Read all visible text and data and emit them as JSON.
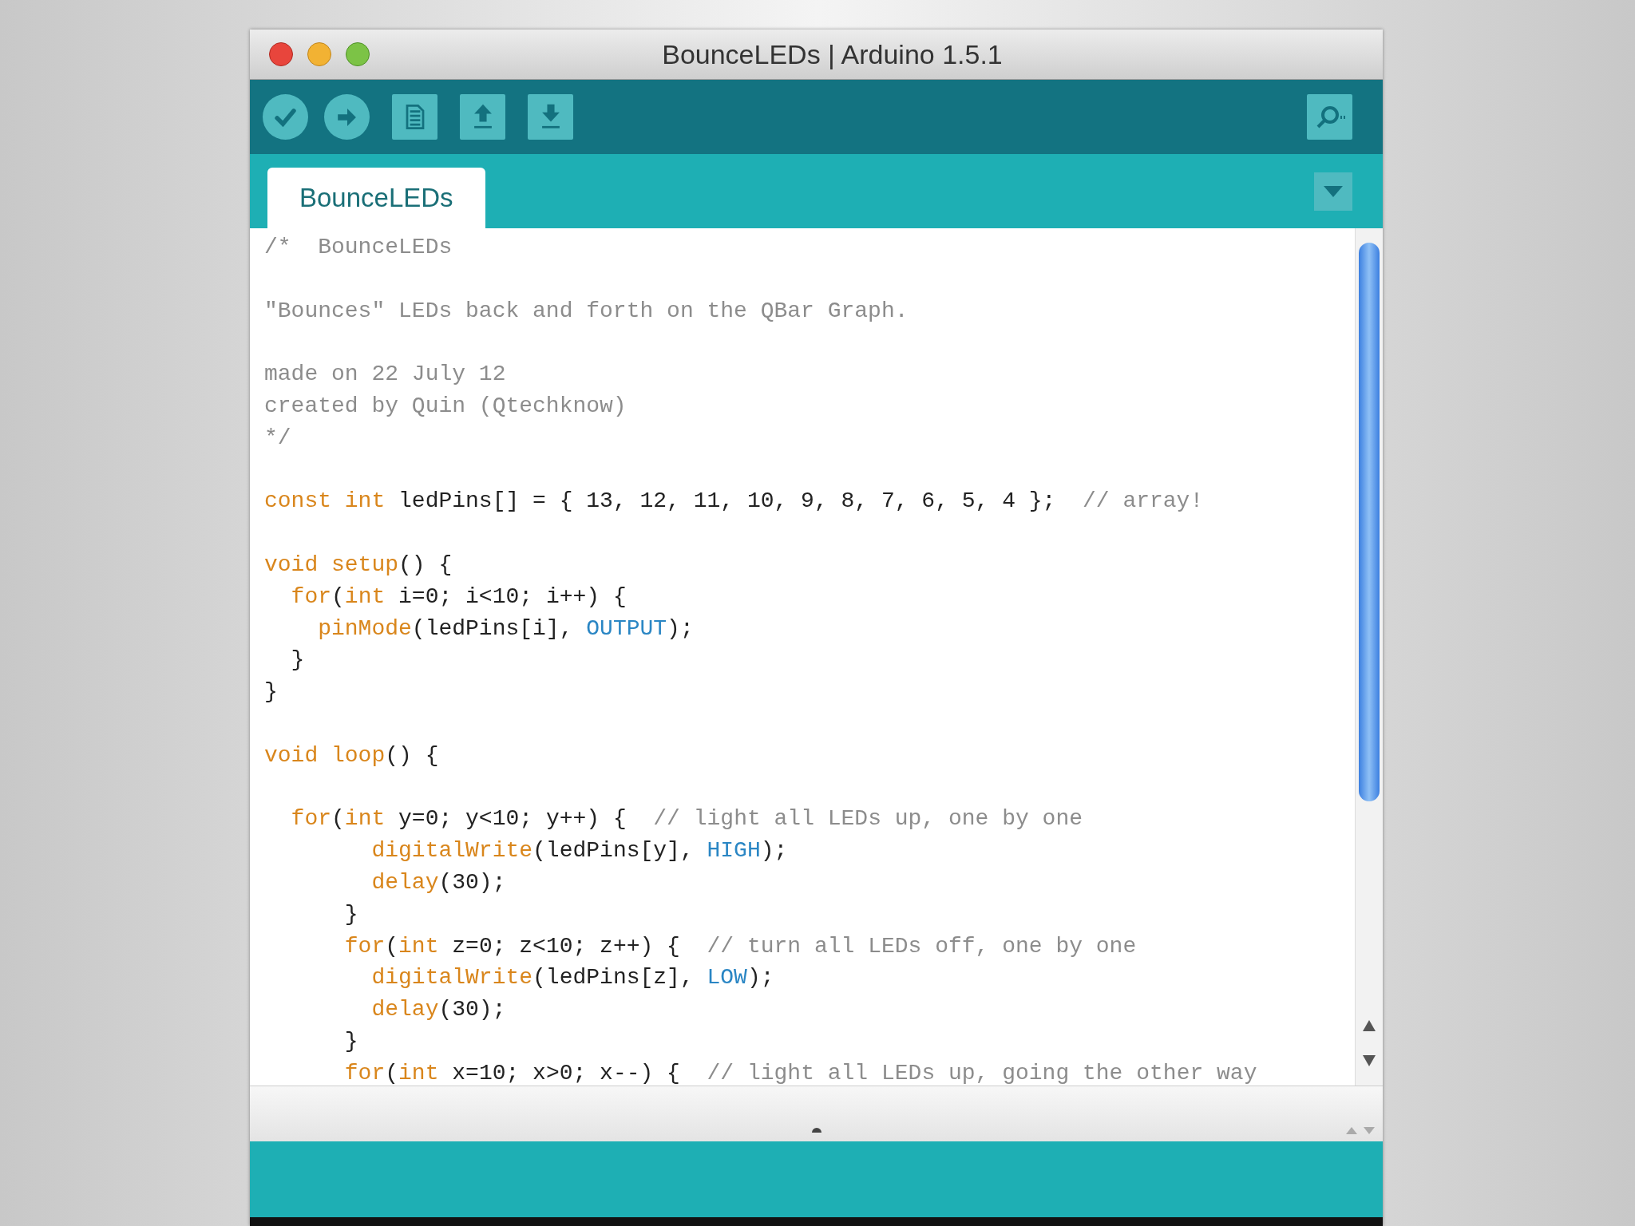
{
  "window": {
    "title": "BounceLEDs | Arduino 1.5.1"
  },
  "toolbar": {
    "buttons": [
      {
        "kind": "verify"
      },
      {
        "kind": "upload"
      },
      {
        "kind": "new"
      },
      {
        "kind": "open"
      },
      {
        "kind": "save"
      }
    ]
  },
  "tabs": [
    {
      "label": "BounceLEDs",
      "selected": true
    }
  ],
  "editor": {
    "lines": [
      {
        "kind": "code",
        "tokens": [
          {
            "text": "/*  BounceLEDs",
            "kind": "comment"
          }
        ]
      },
      {
        "kind": "blank"
      },
      {
        "kind": "code",
        "tokens": [
          {
            "text": "\"Bounces\" LEDs back and forth on the QBar Graph.",
            "kind": "comment"
          }
        ]
      },
      {
        "kind": "blank"
      },
      {
        "kind": "code",
        "tokens": [
          {
            "text": "made on 22 July 12",
            "kind": "comment"
          }
        ]
      },
      {
        "kind": "code",
        "tokens": [
          {
            "text": "created by Quin (Qtechknow)",
            "kind": "comment"
          }
        ]
      },
      {
        "kind": "code",
        "tokens": [
          {
            "text": "*/",
            "kind": "comment"
          }
        ]
      },
      {
        "kind": "blank"
      },
      {
        "kind": "code",
        "tokens": [
          {
            "text": "const int",
            "kind": "keyword"
          },
          {
            "text": " ledPins[] = { 13, 12, 11, 10, 9, 8, 7, 6, 5, 4 };  ",
            "kind": "plain"
          },
          {
            "text": "// array!",
            "kind": "comment"
          }
        ]
      },
      {
        "kind": "blank"
      },
      {
        "kind": "code",
        "tokens": [
          {
            "text": "void setup",
            "kind": "keyword"
          },
          {
            "text": "() {",
            "kind": "plain"
          }
        ]
      },
      {
        "kind": "code",
        "tokens": [
          {
            "text": "  for",
            "kind": "keyword"
          },
          {
            "text": "(",
            "kind": "plain"
          },
          {
            "text": "int",
            "kind": "keyword"
          },
          {
            "text": " i=0; i<10; i++) {",
            "kind": "plain"
          }
        ]
      },
      {
        "kind": "code",
        "tokens": [
          {
            "text": "    pinMode",
            "kind": "keyword"
          },
          {
            "text": "(ledPins[i], ",
            "kind": "plain"
          },
          {
            "text": "OUTPUT",
            "kind": "constant"
          },
          {
            "text": ");",
            "kind": "plain"
          }
        ]
      },
      {
        "kind": "code",
        "tokens": [
          {
            "text": "  }",
            "kind": "plain"
          }
        ]
      },
      {
        "kind": "code",
        "tokens": [
          {
            "text": "}",
            "kind": "plain"
          }
        ]
      },
      {
        "kind": "blank"
      },
      {
        "kind": "code",
        "tokens": [
          {
            "text": "void loop",
            "kind": "keyword"
          },
          {
            "text": "() {",
            "kind": "plain"
          }
        ]
      },
      {
        "kind": "blank"
      },
      {
        "kind": "code",
        "tokens": [
          {
            "text": "  for",
            "kind": "keyword"
          },
          {
            "text": "(",
            "kind": "plain"
          },
          {
            "text": "int",
            "kind": "keyword"
          },
          {
            "text": " y=0; y<10; y++) {  ",
            "kind": "plain"
          },
          {
            "text": "// light all LEDs up, one by one",
            "kind": "comment"
          }
        ]
      },
      {
        "kind": "code",
        "tokens": [
          {
            "text": "        digitalWrite",
            "kind": "keyword"
          },
          {
            "text": "(ledPins[y], ",
            "kind": "plain"
          },
          {
            "text": "HIGH",
            "kind": "constant"
          },
          {
            "text": ");",
            "kind": "plain"
          }
        ]
      },
      {
        "kind": "code",
        "tokens": [
          {
            "text": "        delay",
            "kind": "keyword"
          },
          {
            "text": "(30);",
            "kind": "plain"
          }
        ]
      },
      {
        "kind": "code",
        "tokens": [
          {
            "text": "      }",
            "kind": "plain"
          }
        ]
      },
      {
        "kind": "code",
        "tokens": [
          {
            "text": "      for",
            "kind": "keyword"
          },
          {
            "text": "(",
            "kind": "plain"
          },
          {
            "text": "int",
            "kind": "keyword"
          },
          {
            "text": " z=0; z<10; z++) {  ",
            "kind": "plain"
          },
          {
            "text": "// turn all LEDs off, one by one",
            "kind": "comment"
          }
        ]
      },
      {
        "kind": "code",
        "tokens": [
          {
            "text": "        digitalWrite",
            "kind": "keyword"
          },
          {
            "text": "(ledPins[z], ",
            "kind": "plain"
          },
          {
            "text": "LOW",
            "kind": "constant"
          },
          {
            "text": ");",
            "kind": "plain"
          }
        ]
      },
      {
        "kind": "code",
        "tokens": [
          {
            "text": "        delay",
            "kind": "keyword"
          },
          {
            "text": "(30);",
            "kind": "plain"
          }
        ]
      },
      {
        "kind": "code",
        "tokens": [
          {
            "text": "      }",
            "kind": "plain"
          }
        ]
      },
      {
        "kind": "code",
        "tokens": [
          {
            "text": "      for",
            "kind": "keyword"
          },
          {
            "text": "(",
            "kind": "plain"
          },
          {
            "text": "int",
            "kind": "keyword"
          },
          {
            "text": " x=10; x>0; x--) {  ",
            "kind": "plain"
          },
          {
            "text": "// light all LEDs up, going the other way",
            "kind": "comment"
          }
        ]
      }
    ]
  }
}
